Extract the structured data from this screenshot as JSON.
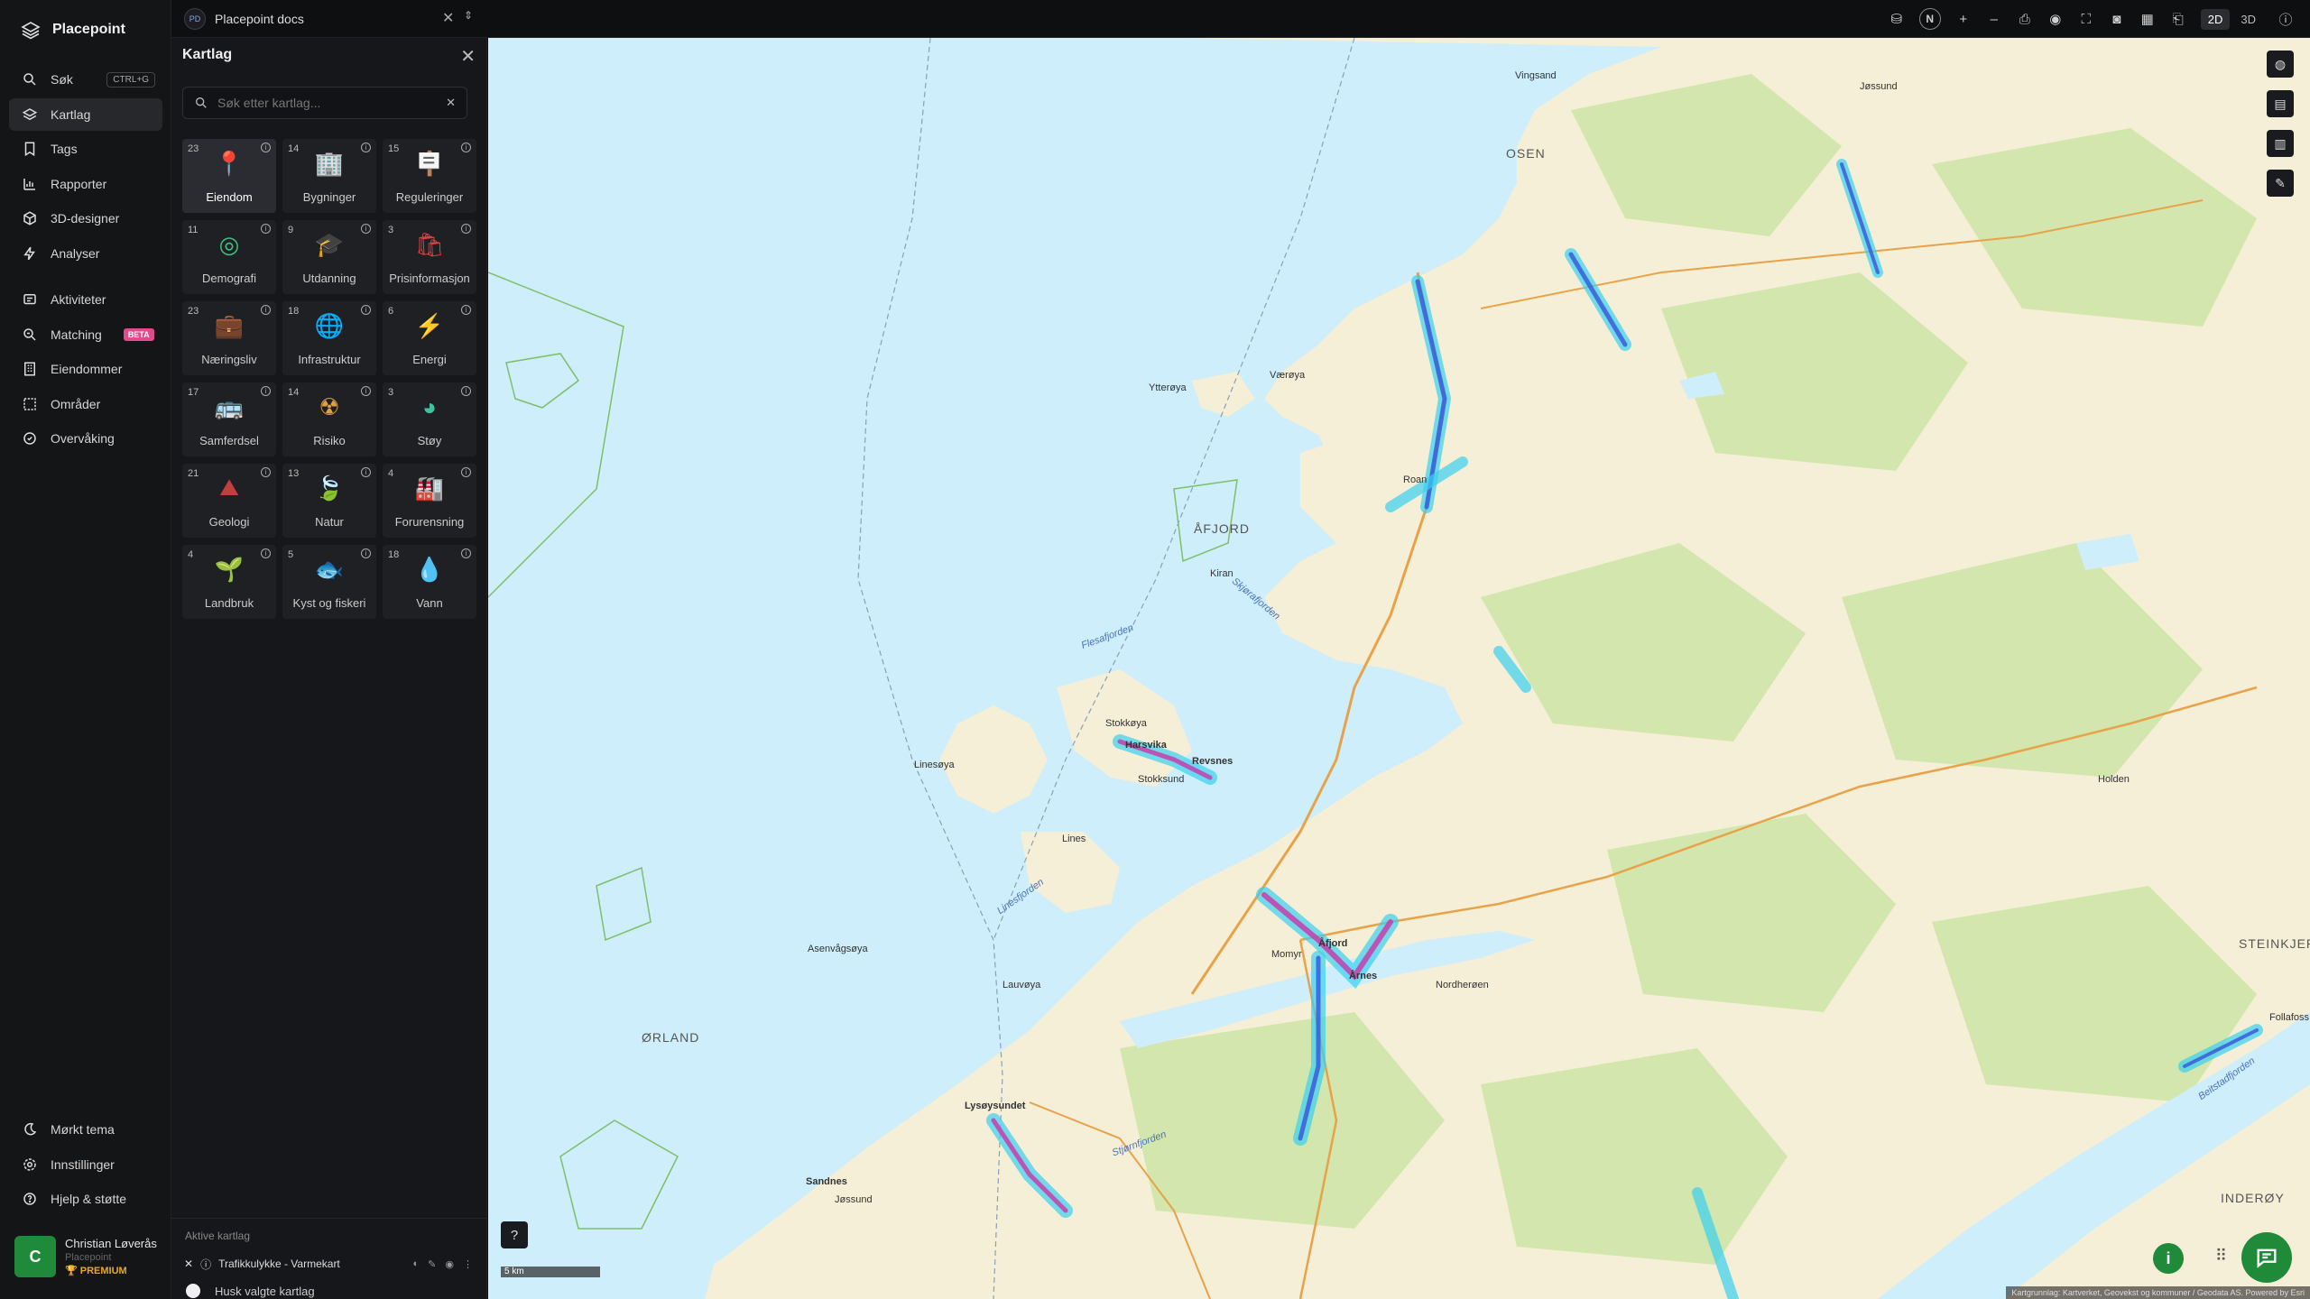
{
  "app": {
    "name": "Placepoint"
  },
  "sidebar": {
    "items": [
      {
        "label": "Søk",
        "shortcut": "CTRL+G",
        "icon": "search-icon"
      },
      {
        "label": "Kartlag",
        "icon": "layers-icon",
        "active": true
      },
      {
        "label": "Tags",
        "icon": "bookmark-icon"
      },
      {
        "label": "Rapporter",
        "icon": "chart-icon"
      },
      {
        "label": "3D-designer",
        "icon": "cube-icon"
      },
      {
        "label": "Analyser",
        "icon": "bolt-icon"
      },
      {
        "label": "Aktiviteter",
        "icon": "activity-icon"
      },
      {
        "label": "Matching",
        "badge": "BETA",
        "icon": "match-icon"
      },
      {
        "label": "Eiendommer",
        "icon": "building-icon"
      },
      {
        "label": "Områder",
        "icon": "area-icon"
      },
      {
        "label": "Overvåking",
        "icon": "monitor-icon"
      }
    ],
    "bottom": [
      {
        "label": "Mørkt tema",
        "icon": "moon-icon"
      },
      {
        "label": "Innstillinger",
        "icon": "gear-icon"
      },
      {
        "label": "Hjelp & støtte",
        "icon": "help-icon"
      }
    ],
    "user": {
      "initial": "C",
      "name": "Christian Løverås",
      "org": "Placepoint",
      "plan": "PREMIUM"
    }
  },
  "tab": {
    "badge": "PD",
    "title": "Placepoint docs"
  },
  "toolbar": {
    "compass": "N",
    "zoom_in": "+",
    "zoom_out": "–",
    "mode_2d": "2D",
    "mode_3d": "3D",
    "active_mode": "2D"
  },
  "panel": {
    "title": "Kartlag",
    "search_placeholder": "Søk etter kartlag...",
    "categories": [
      {
        "count": "23",
        "label": "Eiendom",
        "icon": "property-pin-icon",
        "selected": true
      },
      {
        "count": "14",
        "label": "Bygninger",
        "icon": "buildings-icon"
      },
      {
        "count": "15",
        "label": "Reguleringer",
        "icon": "signpost-icon"
      },
      {
        "count": "11",
        "label": "Demografi",
        "icon": "demography-icon"
      },
      {
        "count": "9",
        "label": "Utdanning",
        "icon": "graduation-cap-icon"
      },
      {
        "count": "3",
        "label": "Prisinformasjon",
        "icon": "shopping-bag-icon"
      },
      {
        "count": "23",
        "label": "Næringsliv",
        "icon": "business-bag-icon"
      },
      {
        "count": "18",
        "label": "Infrastruktur",
        "icon": "globe-icon"
      },
      {
        "count": "6",
        "label": "Energi",
        "icon": "lightning-icon"
      },
      {
        "count": "17",
        "label": "Samferdsel",
        "icon": "bus-icon"
      },
      {
        "count": "14",
        "label": "Risiko",
        "icon": "hazard-icon"
      },
      {
        "count": "3",
        "label": "Støy",
        "icon": "noise-gauge-icon"
      },
      {
        "count": "21",
        "label": "Geologi",
        "icon": "geology-icon"
      },
      {
        "count": "13",
        "label": "Natur",
        "icon": "leaf-icon"
      },
      {
        "count": "4",
        "label": "Forurensning",
        "icon": "factory-icon"
      },
      {
        "count": "4",
        "label": "Landbruk",
        "icon": "sprout-icon"
      },
      {
        "count": "5",
        "label": "Kyst og fiskeri",
        "icon": "fish-icon"
      },
      {
        "count": "18",
        "label": "Vann",
        "icon": "water-drop-icon"
      }
    ],
    "active_title": "Aktive kartlag",
    "active_layers": [
      {
        "label": "Trafikkulykke - Varmekart"
      }
    ],
    "remember_label": "Husk valgte kartlag"
  },
  "map": {
    "labels": [
      {
        "text": "ØRLAND",
        "kind": "big"
      },
      {
        "text": "ÅFJORD",
        "kind": "big"
      },
      {
        "text": "STEINKJER",
        "kind": "big"
      },
      {
        "text": "INDERØY",
        "kind": "big"
      },
      {
        "text": "OSEN",
        "kind": "big"
      },
      {
        "text": "Årnes",
        "kind": "place"
      },
      {
        "text": "Åfjord",
        "kind": "place"
      },
      {
        "text": "Revsnes",
        "kind": "place"
      },
      {
        "text": "Stokkøya",
        "kind": "place"
      },
      {
        "text": "Harsvika",
        "kind": "place"
      },
      {
        "text": "Stokksund",
        "kind": "place"
      },
      {
        "text": "Lauvøya",
        "kind": "place"
      },
      {
        "text": "Linesøya",
        "kind": "place"
      },
      {
        "text": "Lines",
        "kind": "place"
      },
      {
        "text": "Asenvågsøya",
        "kind": "place"
      },
      {
        "text": "Værøya",
        "kind": "place"
      },
      {
        "text": "Ytterøya",
        "kind": "place"
      },
      {
        "text": "Kiran",
        "kind": "place"
      },
      {
        "text": "Roan",
        "kind": "place"
      },
      {
        "text": "Lysøysundet",
        "kind": "place"
      },
      {
        "text": "Sandnes",
        "kind": "place"
      },
      {
        "text": "Jøssund",
        "kind": "place"
      },
      {
        "text": "Stjørnfjorden",
        "kind": "sea"
      },
      {
        "text": "Linesfjorden",
        "kind": "sea"
      },
      {
        "text": "Skjørafjorden",
        "kind": "sea"
      },
      {
        "text": "Flesafjorden",
        "kind": "sea"
      },
      {
        "text": "Beitstadfjorden",
        "kind": "sea"
      },
      {
        "text": "Momyr",
        "kind": "place"
      },
      {
        "text": "Nordherøen",
        "kind": "place"
      },
      {
        "text": "Follafoss",
        "kind": "place"
      },
      {
        "text": "Holden",
        "kind": "place"
      },
      {
        "text": "Vingsand",
        "kind": "place"
      },
      {
        "text": "Jøssund",
        "kind": "place"
      }
    ],
    "scale": "5 km",
    "attribution": "Kartgrunnlag: Kartverket, Geovekst og kommuner / Geodata AS. Powered by Esri"
  },
  "colors": {
    "accent": "#1f8a3a",
    "water": "#cdeefa",
    "land": "#f3eed2",
    "forest": "#cfe3a8",
    "heat": "#3ad0f0",
    "road": "#e8a24a"
  }
}
